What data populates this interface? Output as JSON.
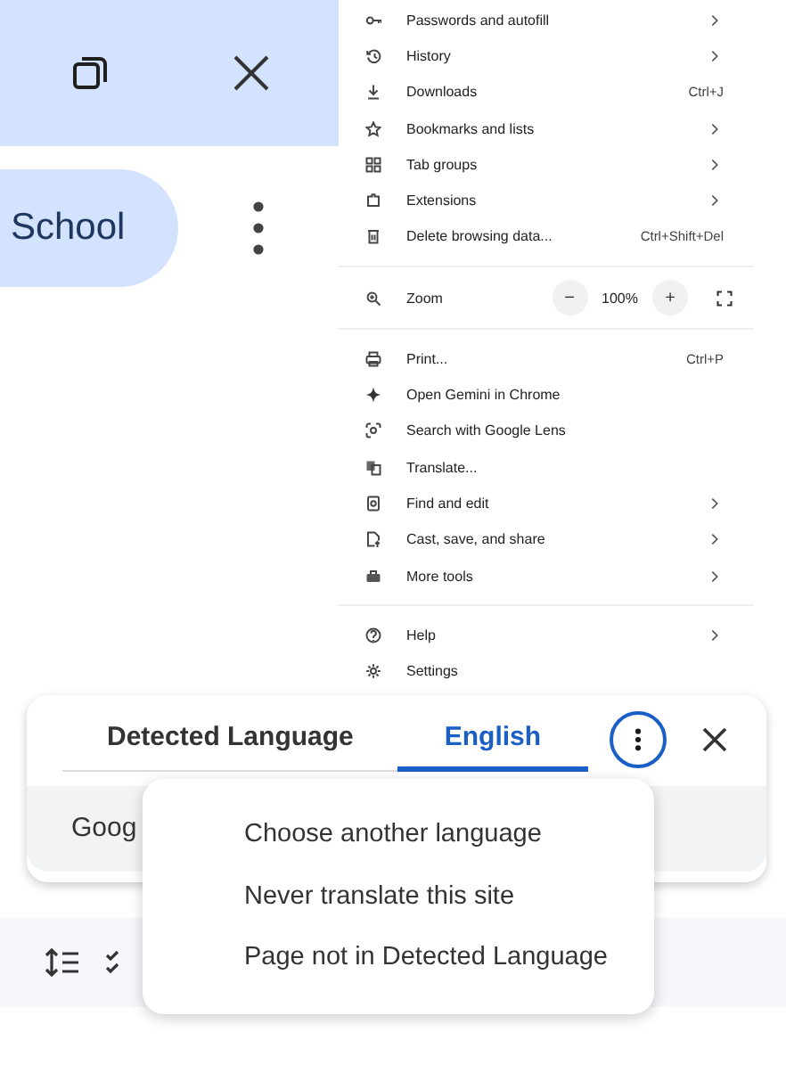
{
  "tab_chip": {
    "label": "School"
  },
  "chrome_menu": {
    "groups": [
      [
        {
          "kind": "submenu",
          "label": "Passwords and autofill"
        },
        {
          "kind": "submenu",
          "label": "History"
        },
        {
          "kind": "shortcut",
          "label": "Downloads",
          "shortcut": "Ctrl+J"
        },
        {
          "kind": "submenu",
          "label": "Bookmarks and lists"
        },
        {
          "kind": "submenu",
          "label": "Tab groups"
        },
        {
          "kind": "submenu",
          "label": "Extensions"
        },
        {
          "kind": "shortcut",
          "label": "Delete browsing data...",
          "shortcut": "Ctrl+Shift+Del"
        }
      ],
      [
        {
          "kind": "zoom",
          "label": "Zoom",
          "minus": "−",
          "value": "100%",
          "plus": "+"
        }
      ],
      [
        {
          "kind": "shortcut",
          "label": "Print...",
          "shortcut": "Ctrl+P"
        },
        {
          "kind": "plain",
          "label": "Open Gemini in Chrome"
        },
        {
          "kind": "plain",
          "label": "Search with Google Lens"
        },
        {
          "kind": "plain",
          "label": "Translate..."
        },
        {
          "kind": "submenu",
          "label": "Find and edit"
        },
        {
          "kind": "submenu",
          "label": "Cast, save, and share"
        },
        {
          "kind": "submenu",
          "label": "More tools"
        }
      ],
      [
        {
          "kind": "submenu",
          "label": "Help"
        },
        {
          "kind": "plain",
          "label": "Settings"
        }
      ]
    ]
  },
  "page_behind": {
    "toolbar_text": "Goog"
  },
  "translate_bubble": {
    "tabs": [
      {
        "label": "Detected Language",
        "selected": false
      },
      {
        "label": "English",
        "selected": true
      }
    ],
    "options_expanded": true,
    "options_menu": [
      "Choose another language",
      "Never translate this site",
      "Page not in Detected Language"
    ]
  }
}
